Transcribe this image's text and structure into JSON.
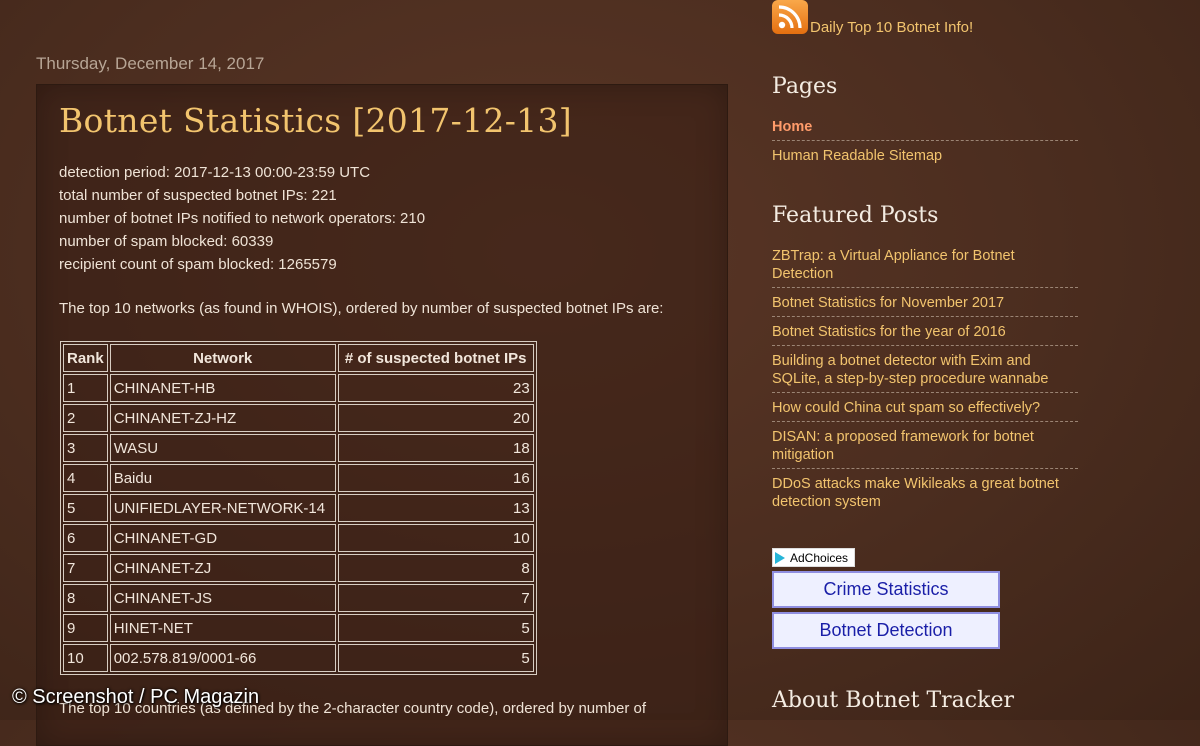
{
  "post": {
    "date": "Thursday, December 14, 2017",
    "title": "Botnet Statistics [2017-12-13]",
    "stats": [
      "detection period: 2017-12-13 00:00-23:59 UTC",
      "total number of suspected botnet IPs: 221",
      "number of botnet IPs notified to network operators: 210",
      "number of spam blocked: 60339",
      "recipient count of spam blocked: 1265579"
    ],
    "networks_intro": "The top 10 networks (as found in WHOIS), ordered by number of suspected botnet IPs are:",
    "table": {
      "headers": [
        "Rank",
        "Network",
        "# of suspected botnet IPs"
      ],
      "rows": [
        [
          "1",
          "CHINANET-HB",
          "23"
        ],
        [
          "2",
          "CHINANET-ZJ-HZ",
          "20"
        ],
        [
          "3",
          "WASU",
          "18"
        ],
        [
          "4",
          "Baidu",
          "16"
        ],
        [
          "5",
          "UNIFIEDLAYER-NETWORK-14",
          "13"
        ],
        [
          "6",
          "CHINANET-GD",
          "10"
        ],
        [
          "7",
          "CHINANET-ZJ",
          "8"
        ],
        [
          "8",
          "CHINANET-JS",
          "7"
        ],
        [
          "9",
          "HINET-NET",
          "5"
        ],
        [
          "10",
          "002.578.819/0001-66",
          "5"
        ]
      ]
    },
    "countries_intro": "The top 10 countries (as defined by the 2-character country code), ordered by number of"
  },
  "watermark": "© Screenshot / PC Magazin",
  "sidebar": {
    "rss_label": "Daily Top 10 Botnet Info!",
    "pages_heading": "Pages",
    "pages": [
      {
        "label": "Home",
        "active": true
      },
      {
        "label": "Human Readable Sitemap",
        "active": false
      }
    ],
    "featured_heading": "Featured Posts",
    "featured": [
      "ZBTrap: a Virtual Appliance for Botnet Detection",
      "Botnet Statistics for November 2017",
      "Botnet Statistics for the year of 2016",
      "Building a botnet detector with Exim and SQLite, a step-by-step procedure wannabe",
      "How could China cut spam so effectively?",
      "DISAN: a proposed framework for botnet mitigation",
      "DDoS attacks make Wikileaks a great botnet detection system"
    ],
    "adchoices_label": "AdChoices",
    "ad_buttons": [
      "Crime Statistics",
      "Botnet Detection"
    ],
    "about_heading": "About Botnet Tracker"
  },
  "colors": {
    "background": "#4b2d1f",
    "title_gold": "#f2c46e",
    "link_gold": "#f2c46e",
    "active_link": "#ff9b6a",
    "ad_button_text": "#1a1fa8"
  },
  "icons": {
    "rss": "rss-feed-icon",
    "adchoices": "adchoices-icon"
  }
}
